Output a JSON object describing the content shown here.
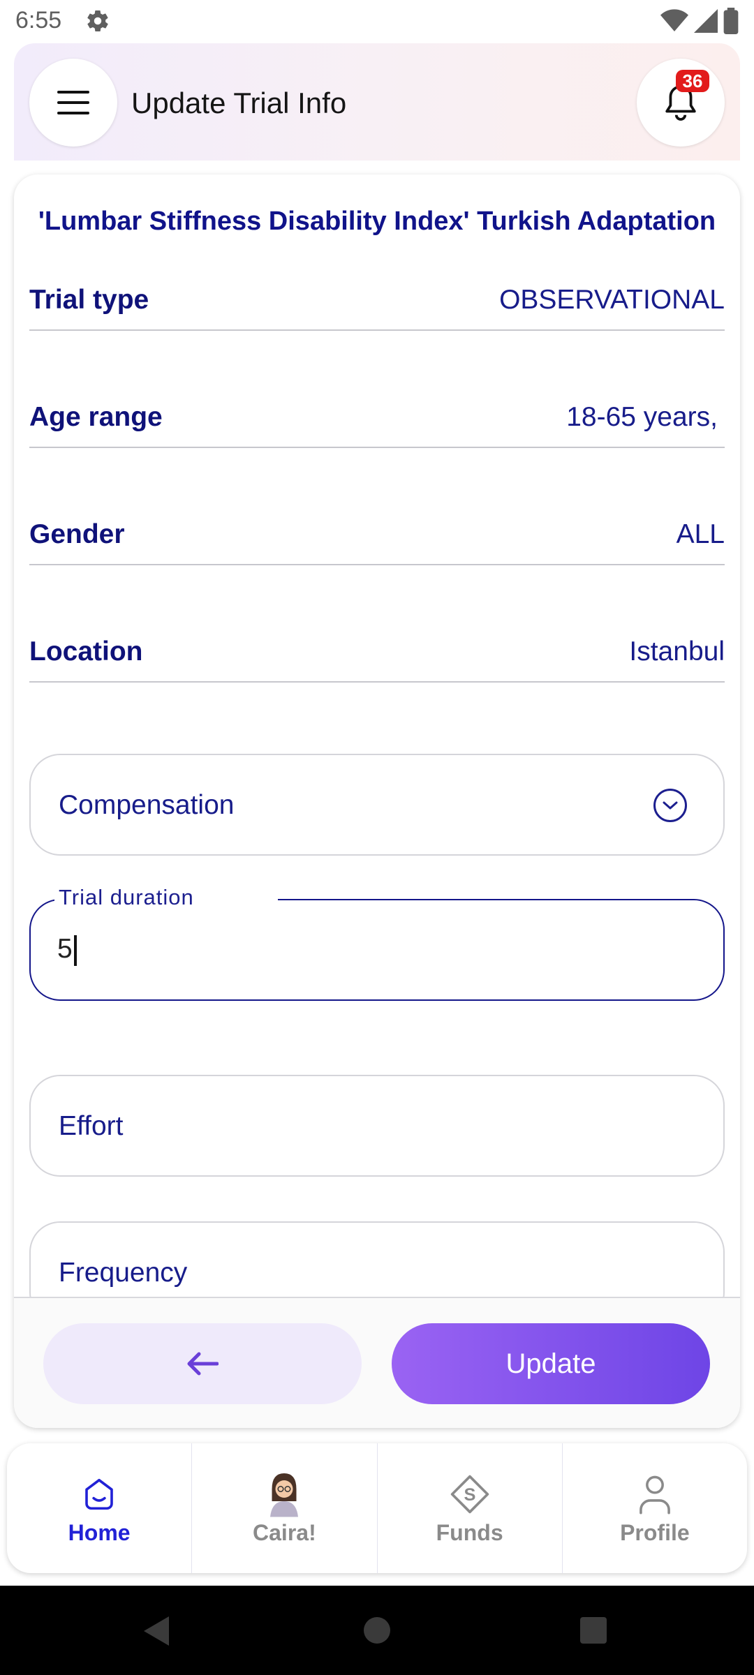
{
  "status_bar": {
    "time": "6:55"
  },
  "header": {
    "title": "Update Trial Info",
    "notification_count": "36"
  },
  "trial": {
    "title": "'Lumbar Stiffness Disability Index' Turkish Adaptation",
    "rows": [
      {
        "label": "Trial type",
        "value": "OBSERVATIONAL"
      },
      {
        "label": "Age range",
        "value": "18-65 years,"
      },
      {
        "label": "Gender",
        "value": "ALL"
      },
      {
        "label": "Location",
        "value": "Istanbul"
      }
    ],
    "compensation_label": "Compensation",
    "duration": {
      "label": "Trial duration",
      "value": "5"
    },
    "effort_placeholder": "Effort",
    "frequency_placeholder": "Frequency"
  },
  "actions": {
    "update_label": "Update"
  },
  "tabs": [
    {
      "label": "Home",
      "icon": "home-icon"
    },
    {
      "label": "Caira!",
      "icon": "caira-avatar"
    },
    {
      "label": "Funds",
      "icon": "funds-icon"
    },
    {
      "label": "Profile",
      "icon": "profile-icon"
    }
  ],
  "colors": {
    "primary_text": "#10138a",
    "accent": "#6e45e6",
    "active_tab": "#2121d6",
    "badge": "#e21b1b"
  }
}
